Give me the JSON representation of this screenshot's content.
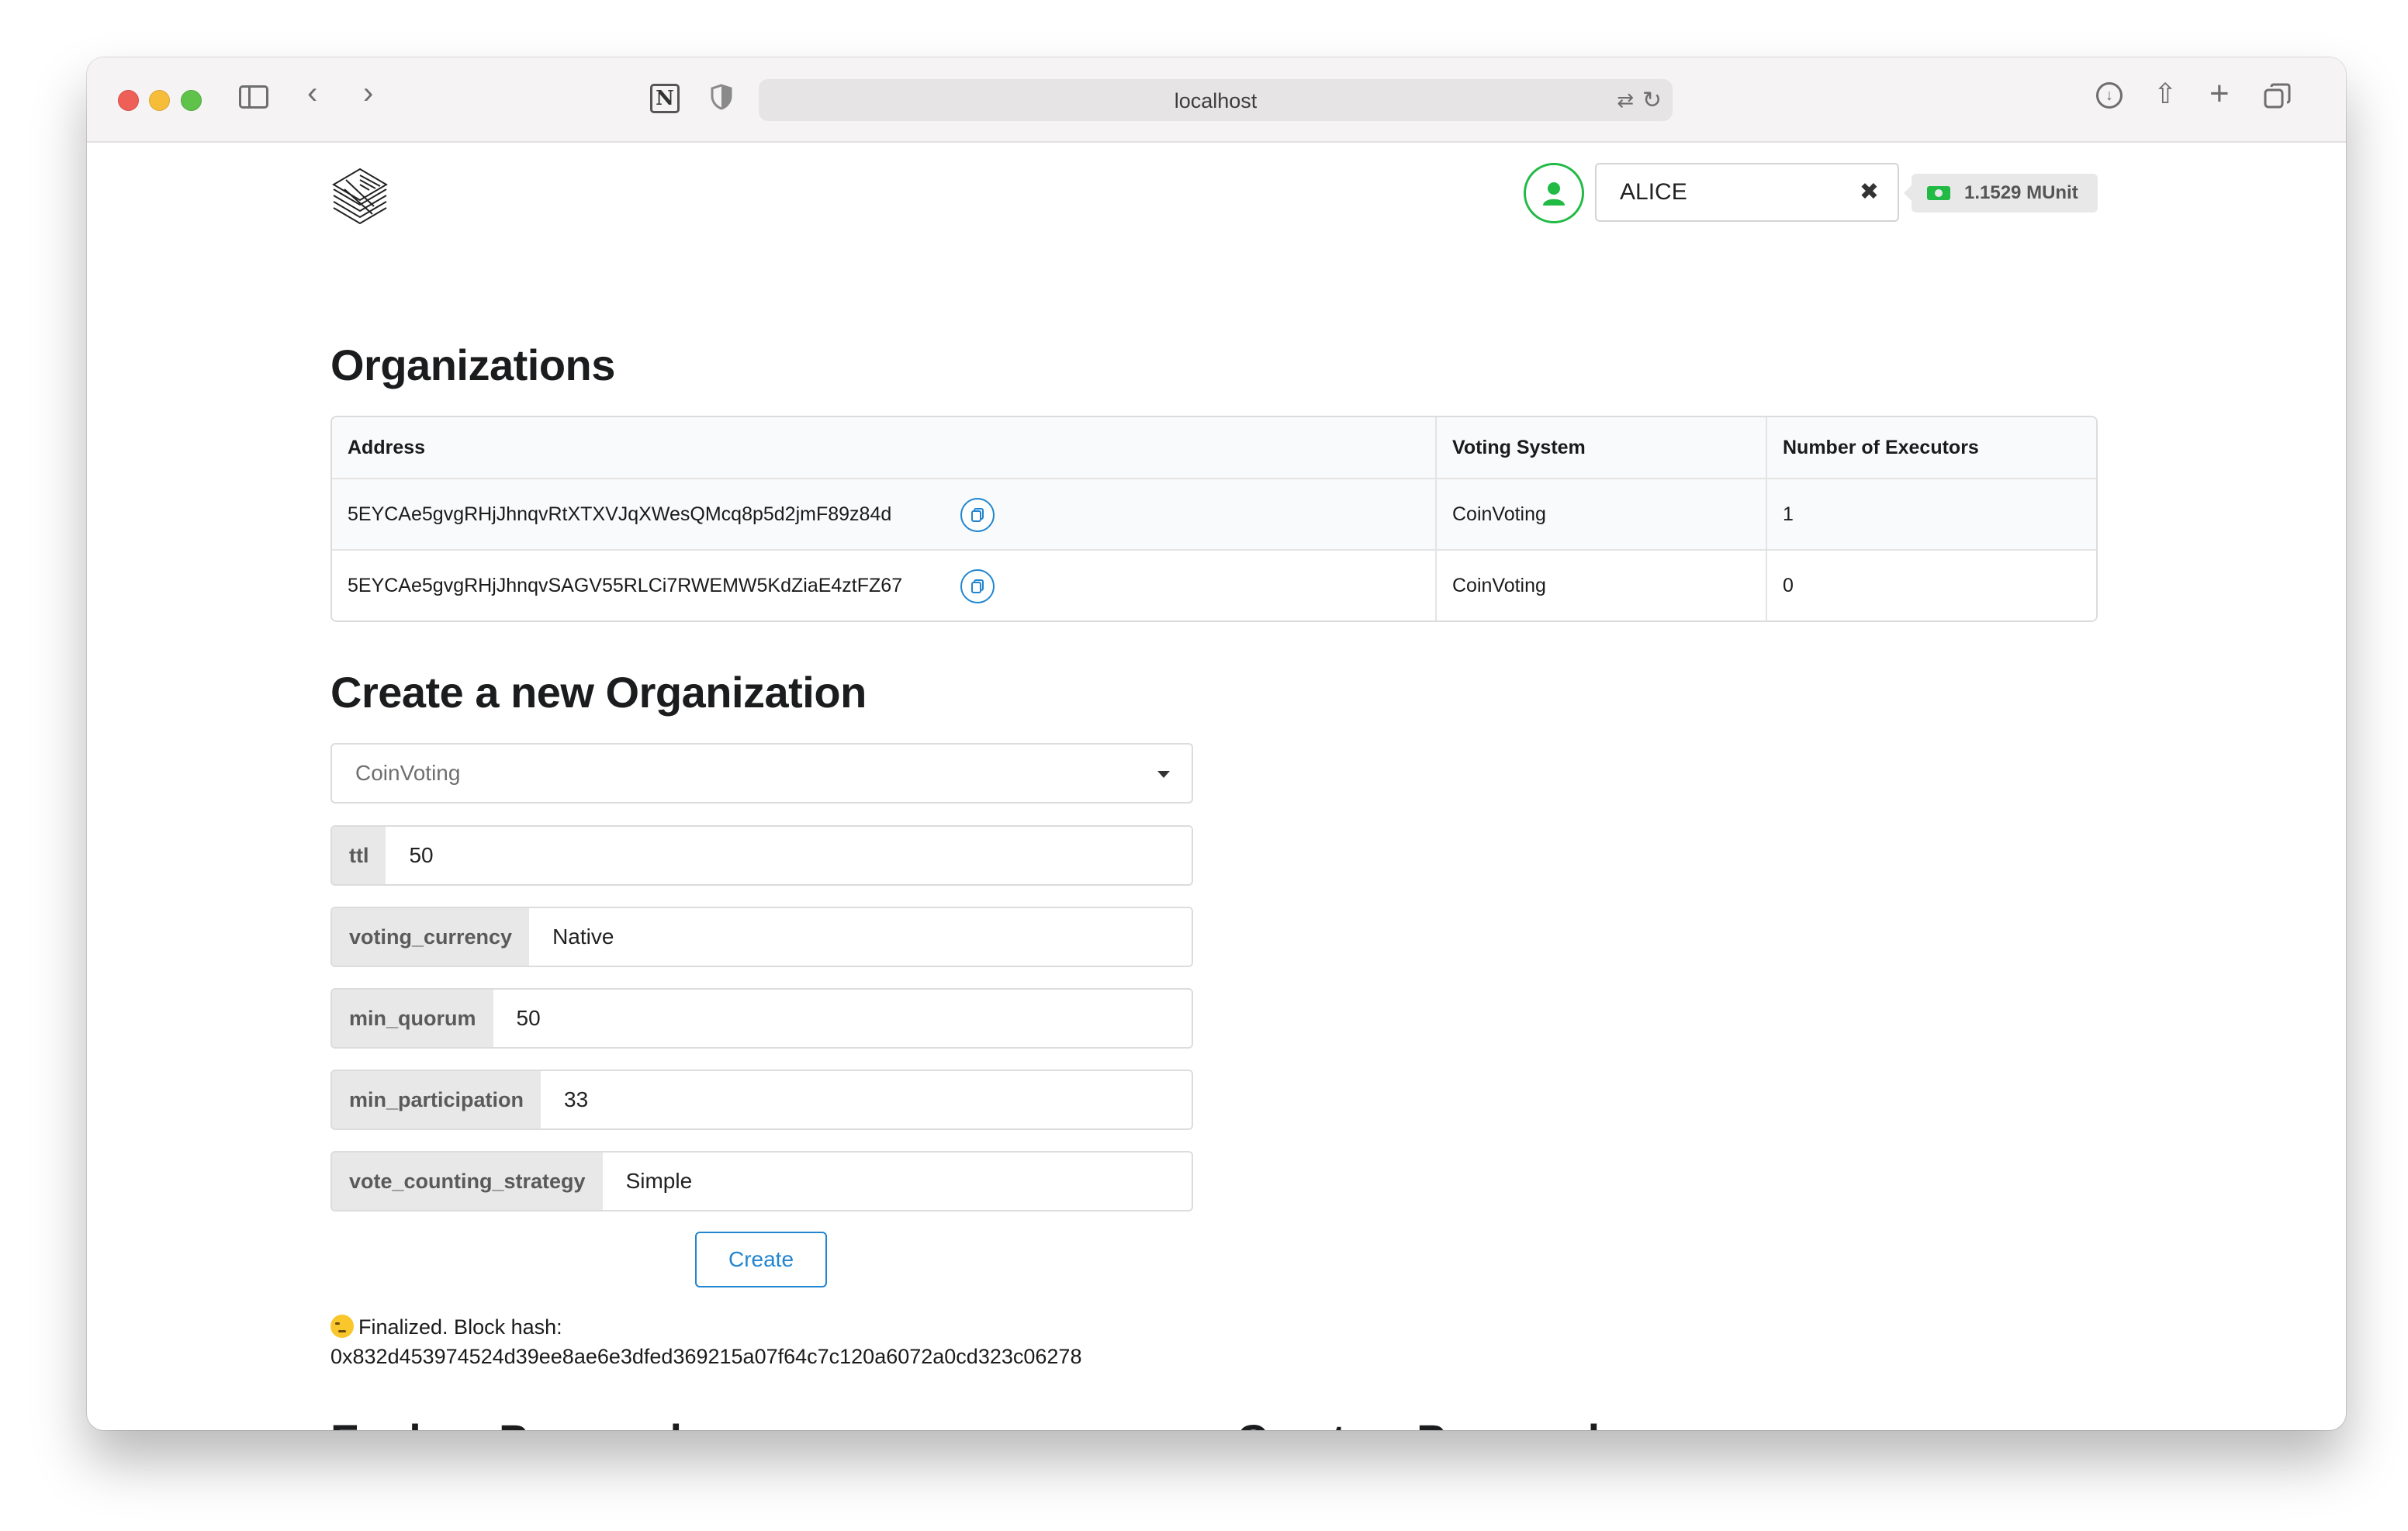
{
  "browser": {
    "url": "localhost"
  },
  "account": {
    "name": "ALICE",
    "balance": "1.1529 MUnit"
  },
  "organizations": {
    "title": "Organizations",
    "columns": [
      "Address",
      "Voting System",
      "Number of Executors"
    ],
    "rows": [
      {
        "address": "5EYCAe5gvgRHjJhnqvRtXTXVJqXWesQMcq8p5d2jmF89z84d",
        "voting_system": "CoinVoting",
        "executors": "1"
      },
      {
        "address": "5EYCAe5gvgRHjJhnqvSAGV55RLCi7RWEMW5KdZiaE4ztFZ67",
        "voting_system": "CoinVoting",
        "executors": "0"
      }
    ]
  },
  "create_org": {
    "title": "Create a new Organization",
    "voting_system_selected": "CoinVoting",
    "fields": [
      {
        "label": "ttl",
        "value": "50"
      },
      {
        "label": "voting_currency",
        "value": "Native"
      },
      {
        "label": "min_quorum",
        "value": "50"
      },
      {
        "label": "min_participation",
        "value": "33"
      },
      {
        "label": "vote_counting_strategy",
        "value": "Simple"
      }
    ],
    "button": "Create",
    "status_line1": "Finalized. Block hash:",
    "status_line2": "0x832d453974524d39ee8ae6e3dfed369215a07f64c7c120a6072a0cd323c06278"
  },
  "sections": {
    "explore_proposals": "Explore Proposals",
    "create_proposal": "Create a Proposal"
  },
  "colors": {
    "accent": "#2185d0",
    "success": "#21ba45"
  }
}
